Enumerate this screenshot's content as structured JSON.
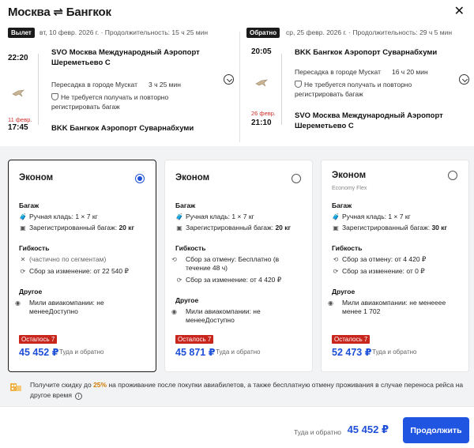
{
  "header": {
    "title": "Москва ⇌ Бангкок",
    "close_icon": "close-icon"
  },
  "outbound": {
    "badge": "Вылет",
    "meta": "вт, 10 февр. 2026 г. · Продолжительность: 15 ч 25 мин",
    "dep_time": "22:20",
    "dep_airport": "SVO Москва Международный Аэропорт Шереметьево С",
    "transfer_city": "Пересадка в городе Мускат",
    "transfer_duration": "3 ч 25 мин",
    "baggage_note": "Не требуется получать и повторно регистрировать багаж",
    "arr_date": "11 февр.",
    "arr_time": "17:45",
    "arr_airport": "BKK Бангкок Аэропорт Суварнабхуми"
  },
  "inbound": {
    "badge": "Обратно",
    "meta": "ср, 25 февр. 2026 г. · Продолжительность: 29 ч 5 мин",
    "dep_time": "20:05",
    "dep_airport": "BKK Бангкок Аэропорт Суварнабхуми",
    "transfer_city": "Пересадка в городе Мускат",
    "transfer_duration": "16 ч 20 мин",
    "baggage_note": "Не требуется получать и повторно регистрировать багаж",
    "arr_date": "26 февр.",
    "arr_time": "21:10",
    "arr_airport": "SVO Москва Международный Аэропорт Шереметьево С"
  },
  "fares": [
    {
      "title": "Эконом",
      "subtitle": "",
      "selected": true,
      "baggage_label": "Багаж",
      "carry_on": "Ручная кладь: 1 × 7 кг",
      "checked_prefix": "Зарегистрированный багаж: ",
      "checked_value": "20 кг",
      "flex_label": "Гибкость",
      "flex_1": "(частично по сегментам)",
      "flex_2": "Сбор за изменение: от 22 540 ₽",
      "other_label": "Другое",
      "other_1": "Мили авиакомпании: не менееДоступно",
      "remaining": "Осталось 7",
      "price": "45 452 ₽",
      "price_note": "Туда и обратно"
    },
    {
      "title": "Эконом",
      "subtitle": "",
      "selected": false,
      "baggage_label": "Багаж",
      "carry_on": "Ручная кладь: 1 × 7 кг",
      "checked_prefix": "Зарегистрированный багаж: ",
      "checked_value": "20 кг",
      "flex_label": "Гибкость",
      "flex_1": "Сбор за отмену: Бесплатно (в течение 48 ч)",
      "flex_2": "Сбор за изменение: от 4 420 ₽",
      "other_label": "Другое",
      "other_1": "Мили авиакомпании: не менееДоступно",
      "remaining": "Осталось 7",
      "price": "45 871 ₽",
      "price_note": "Туда и обратно"
    },
    {
      "title": "Эконом",
      "subtitle": "Economy Flex",
      "selected": false,
      "baggage_label": "Багаж",
      "carry_on": "Ручная кладь: 1 × 7 кг",
      "checked_prefix": "Зарегистрированный багаж: ",
      "checked_value": "30 кг",
      "flex_label": "Гибкость",
      "flex_1": "Сбор за отмену: от 4 420 ₽",
      "flex_2": "Сбор за изменение: от 0 ₽",
      "other_label": "Другое",
      "other_1": "Мили авиакомпании: не менееее менее 1 702",
      "remaining": "Осталось 7",
      "price": "52 473 ₽",
      "price_note": "Туда и обратно"
    }
  ],
  "promo": {
    "text_before": "Получите скидку до ",
    "highlight": "25%",
    "text_after": " на проживание после покупки авиабилетов, а также бесплатную отмену проживания в случае переноса рейса на другое время"
  },
  "footer": {
    "total_label": "Туда и обратно",
    "total_price": "45 452 ₽",
    "cta_label": "Продолжить"
  },
  "colors": {
    "accent": "#1f55e0",
    "price": "#1d4fd8",
    "remaining_badge": "#c8251d",
    "highlight": "#d07a00"
  }
}
